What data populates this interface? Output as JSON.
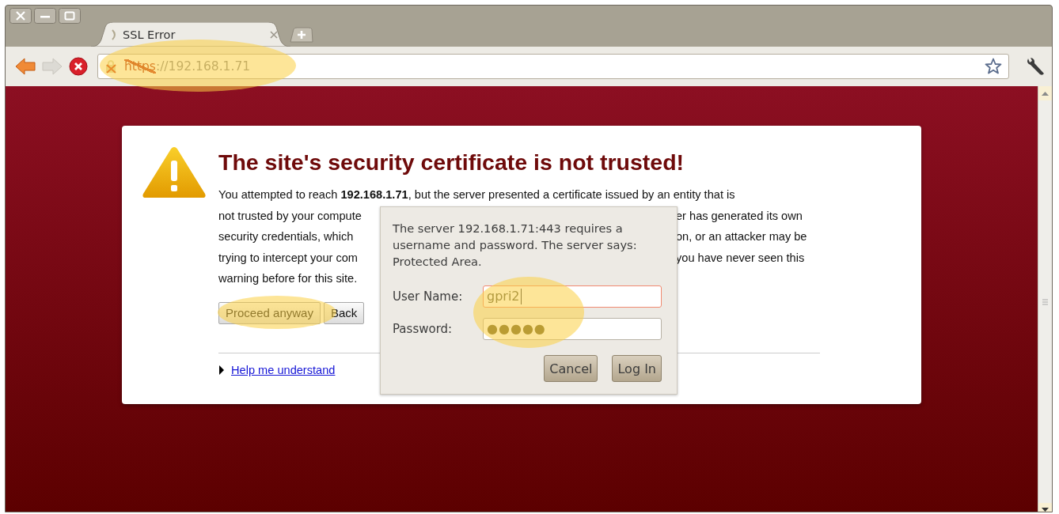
{
  "tab": {
    "title": "SSL Error",
    "loading": true,
    "selected": true
  },
  "address_bar": {
    "scheme": "https",
    "scheme_struck": true,
    "rest": "://192.168.1.71"
  },
  "warning": {
    "title": "The site's security certificate is not trusted!",
    "lines": [
      {
        "left": "You attempted to reach **192.168.1.71**, but the server presented a certificate issued by an entity that is"
      },
      {
        "left": "not trusted by your compute",
        "right": "er has generated its own"
      },
      {
        "left": "security credentials, which",
        "right": "on, or an attacker may be"
      },
      {
        "left": "trying to intercept your com",
        "right": "you have never seen this"
      },
      {
        "left": "warning before for this site."
      }
    ],
    "buttons": [
      "Proceed anyway",
      "Back"
    ],
    "help_link": "Help me understand",
    "help_expanded": false
  },
  "auth_dialog": {
    "message": "The server 192.168.1.71:443 requires a username and password. The server says: Protected Area.",
    "fields": [
      {
        "label": "User Name:",
        "value": "gpri2",
        "focused": true
      },
      {
        "label": "Password:",
        "value": "●●●●●",
        "focused": false
      }
    ],
    "buttons": [
      "Cancel",
      "Log In"
    ]
  }
}
